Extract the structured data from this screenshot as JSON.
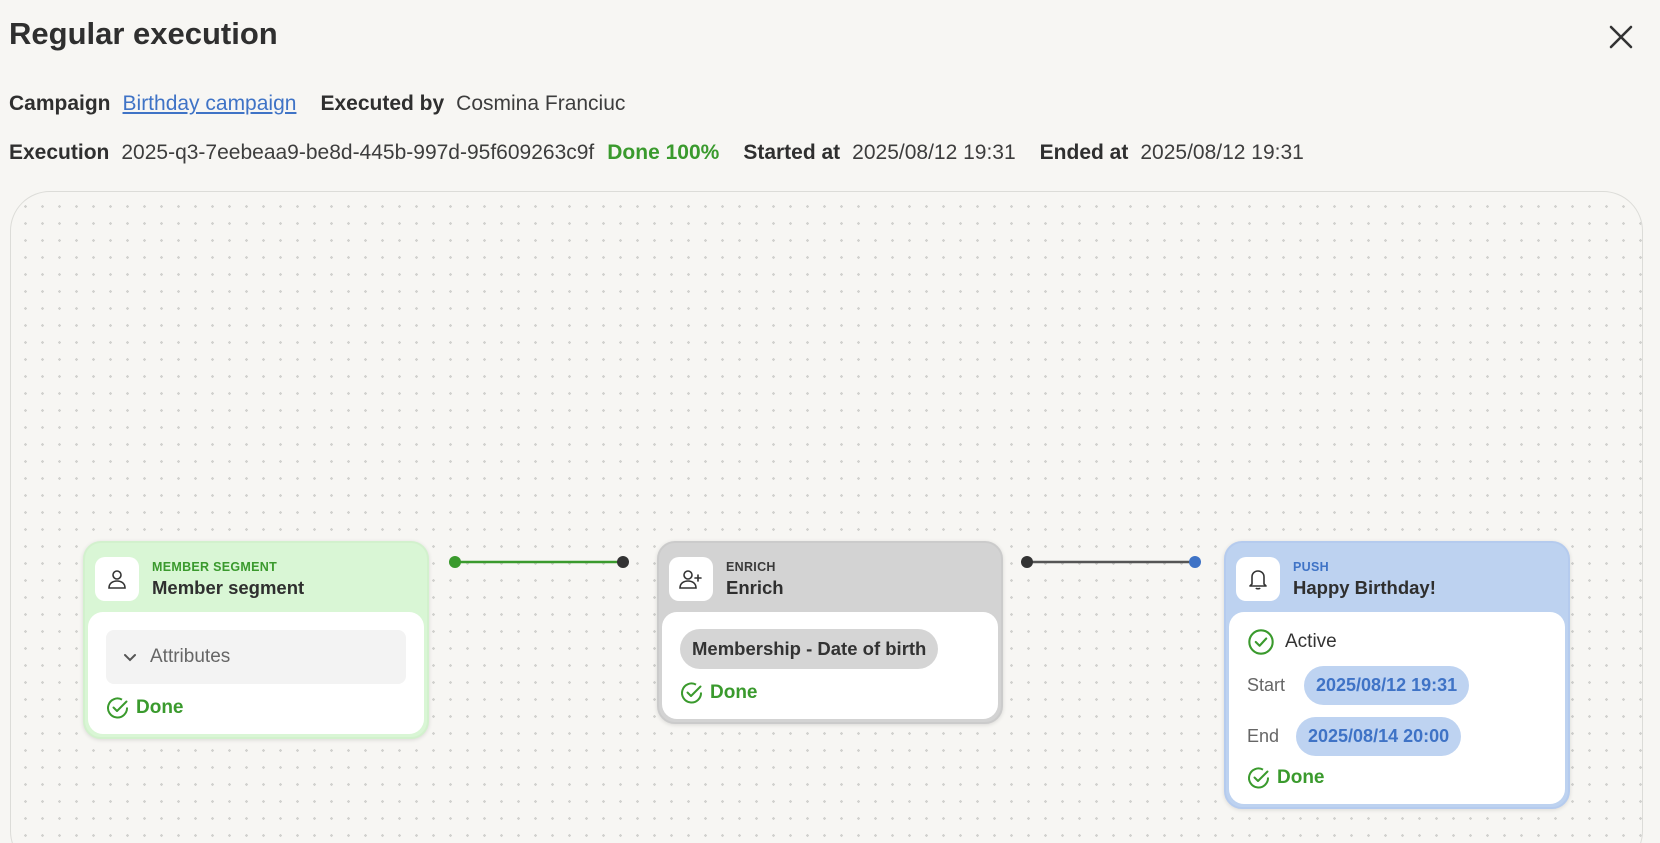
{
  "dialog": {
    "title": "Regular execution"
  },
  "meta": {
    "campaign_label": "Campaign",
    "campaign_value": "Birthday campaign",
    "executed_by_label": "Executed by",
    "executed_by_value": "Cosmina Franciuc",
    "execution_label": "Execution",
    "execution_value": "2025-q3-7eebeaa9-be8d-445b-997d-95f609263c9f",
    "status_text": "Done 100%",
    "started_label": "Started at",
    "started_value": "2025/08/12 19:31",
    "ended_label": "Ended at",
    "ended_value": "2025/08/12 19:31"
  },
  "nodes": {
    "segment": {
      "kind": "MEMBER SEGMENT",
      "name": "Member segment",
      "attributes_label": "Attributes",
      "status": "Done",
      "icon": "user-icon"
    },
    "enrich": {
      "kind": "ENRICH",
      "name": "Enrich",
      "tag": "Membership - Date of birth",
      "status": "Done",
      "icon": "user-plus-icon"
    },
    "push": {
      "kind": "PUSH",
      "name": "Happy Birthday!",
      "active_label": "Active",
      "start_label": "Start",
      "start_value": "2025/08/12 19:31",
      "end_label": "End",
      "end_value": "2025/08/14 20:00",
      "status": "Done",
      "icon": "bell-icon"
    }
  },
  "colors": {
    "green": "#3a9a2d",
    "blue": "#3f73c6",
    "background": "#f7f6f3"
  }
}
